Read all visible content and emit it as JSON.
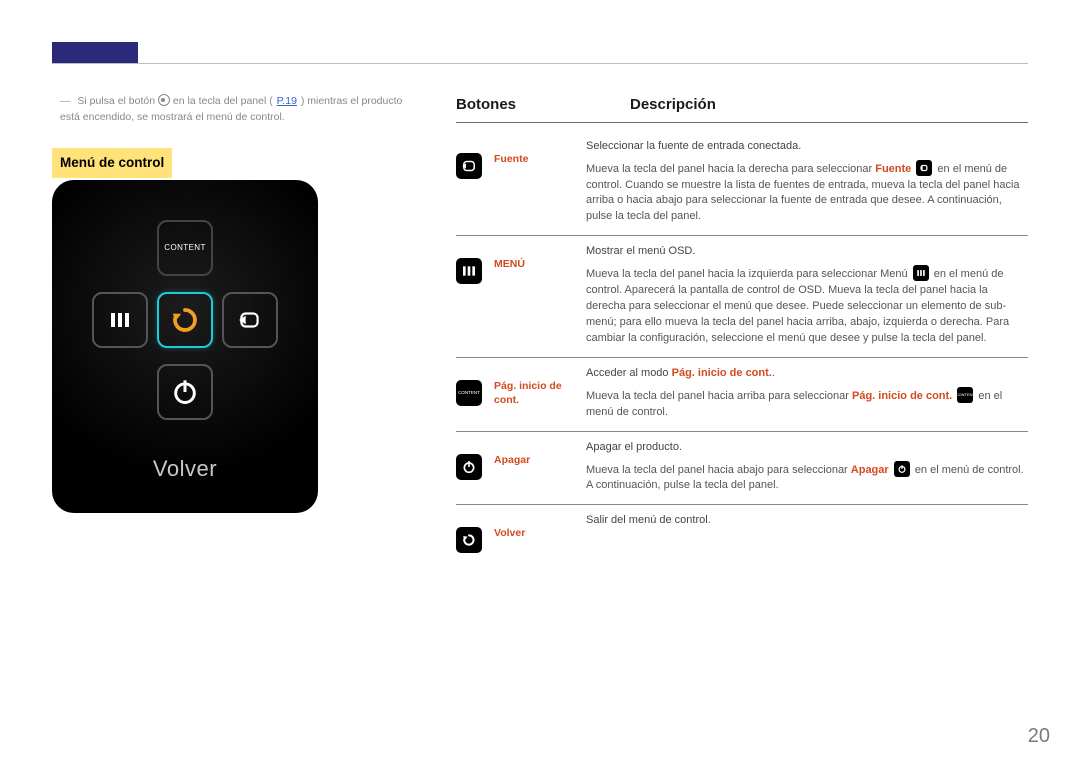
{
  "page_number": "20",
  "hint": {
    "prefix": "Si pulsa el botón ",
    "mid1": " en la tecla del panel (",
    "page_ref": "P.19",
    "mid2": ") mientras el producto está encendido, se mostrará el menú de control."
  },
  "section_title": "Menú de control",
  "panel": {
    "content_label": "CONTENT",
    "volver_label": "Volver"
  },
  "columns": {
    "botones": "Botones",
    "descripcion": "Descripción"
  },
  "rows": {
    "fuente": {
      "label": "Fuente",
      "lead": "Seleccionar la fuente de entrada conectada.",
      "body_a": "Mueva la tecla del panel hacia la derecha para seleccionar ",
      "hl": "Fuente",
      "body_b": " en el menú de control. Cuando se muestre la lista de fuentes de entrada, mueva la tecla del panel hacia arriba o hacia abajo para seleccionar la fuente de entrada que desee. A continuación, pulse la tecla del panel."
    },
    "menu": {
      "label": "MENÚ",
      "lead": "Mostrar el menú OSD.",
      "body_a": "Mueva la tecla del panel hacia la izquierda para seleccionar Menú ",
      "body_b": " en el menú de control. Aparecerá la pantalla de control de OSD. Mueva la tecla del panel hacia la derecha para seleccionar el menú que desee. Puede seleccionar un elemento de sub-menú; para ello mueva la tecla del panel hacia arriba, abajo, izquierda o derecha. Para cambiar la configuración, seleccione el menú que desee y pulse la tecla del panel."
    },
    "content": {
      "label": "Pág. inicio de cont.",
      "lead_a": "Acceder al modo ",
      "lead_hl": "Pág. inicio de cont.",
      "lead_b": ".",
      "body_a": "Mueva la tecla del panel hacia arriba para seleccionar ",
      "hl": "Pág. inicio de cont.",
      "body_b": " en el menú de control.",
      "icon_text": "CONTENT"
    },
    "apagar": {
      "label": "Apagar",
      "lead": "Apagar el producto.",
      "body_a": "Mueva la tecla del panel hacia abajo para seleccionar ",
      "hl": "Apagar",
      "body_b": " en el menú de control. A continuación, pulse la tecla del panel."
    },
    "volver": {
      "label": "Volver",
      "lead": "Salir del menú de control."
    }
  }
}
